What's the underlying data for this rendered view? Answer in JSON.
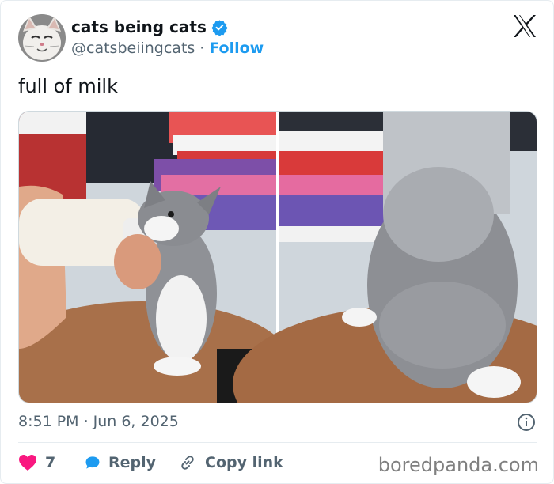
{
  "author": {
    "display_name": "cats being cats",
    "handle": "@catsbeiingcats",
    "separator": "·",
    "follow_label": "Follow",
    "verified": true,
    "verified_color": "#1d9bf0"
  },
  "tweet": {
    "text": "full of milk",
    "time": "8:51 PM",
    "separator": "·",
    "date": "Jun 6, 2025"
  },
  "actions": {
    "like_count": "7",
    "reply_label": "Reply",
    "copy_link_label": "Copy link",
    "like_color": "#f91880",
    "reply_color": "#1d9bf0"
  },
  "watermark": "boredpanda.com",
  "icons": [
    "verified-badge-icon",
    "x-logo-icon",
    "info-icon",
    "heart-icon",
    "reply-bubble-icon",
    "link-icon"
  ]
}
